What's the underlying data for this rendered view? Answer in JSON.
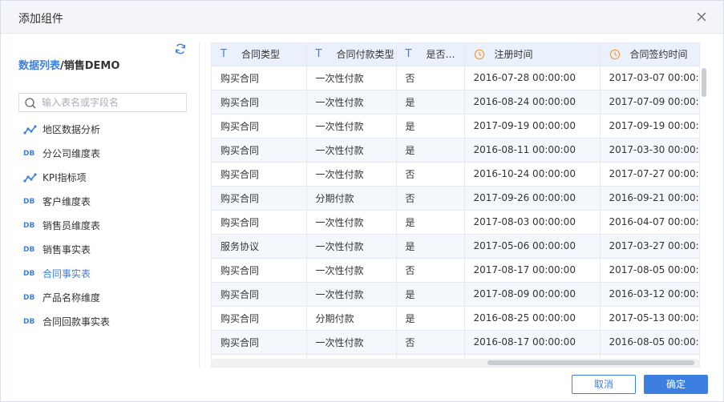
{
  "dialog": {
    "title": "添加组件",
    "cancel_label": "取消",
    "ok_label": "确定"
  },
  "breadcrumb": {
    "root": "数据列表",
    "separator": "/",
    "current": "销售DEMO"
  },
  "search": {
    "placeholder": "输入表名或字段名",
    "value": ""
  },
  "tree": [
    {
      "icon": "analysis-icon",
      "label": "地区数据分析",
      "active": false
    },
    {
      "icon": "db-icon",
      "icon_text": "DB",
      "label": "分公司维度表",
      "active": false
    },
    {
      "icon": "analysis-icon",
      "label": "KPI指标项",
      "active": false
    },
    {
      "icon": "db-icon",
      "icon_text": "DB",
      "label": "客户维度表",
      "active": false
    },
    {
      "icon": "db-icon",
      "icon_text": "DB",
      "label": "销售员维度表",
      "active": false
    },
    {
      "icon": "db-icon",
      "icon_text": "DB",
      "label": "销售事实表",
      "active": false
    },
    {
      "icon": "db-icon",
      "icon_text": "DB",
      "label": "合同事实表",
      "active": true
    },
    {
      "icon": "db-icon",
      "icon_text": "DB",
      "label": "产品名称维度",
      "active": false
    },
    {
      "icon": "db-icon",
      "icon_text": "DB",
      "label": "合同回款事实表",
      "active": false
    }
  ],
  "table": {
    "columns": [
      {
        "type": "text",
        "type_glyph": "T",
        "label": "合同类型"
      },
      {
        "type": "text",
        "type_glyph": "T",
        "label": "合同付款类型"
      },
      {
        "type": "text",
        "type_glyph": "T",
        "label": "是否已..."
      },
      {
        "type": "date",
        "type_glyph": "clock-icon",
        "label": "注册时间"
      },
      {
        "type": "date",
        "type_glyph": "clock-icon",
        "label": "合同签约时间"
      }
    ],
    "rows": [
      [
        "购买合同",
        "一次性付款",
        "否",
        "2016-07-28 00:00:00",
        "2017-03-07 00:00:00"
      ],
      [
        "购买合同",
        "一次性付款",
        "是",
        "2016-08-24 00:00:00",
        "2017-07-09 00:00:00"
      ],
      [
        "购买合同",
        "一次性付款",
        "是",
        "2017-09-19 00:00:00",
        "2017-09-19 00:00:00"
      ],
      [
        "购买合同",
        "一次性付款",
        "是",
        "2016-08-11 00:00:00",
        "2017-03-30 00:00:00"
      ],
      [
        "购买合同",
        "一次性付款",
        "否",
        "2016-10-24 00:00:00",
        "2017-07-27 00:00:00"
      ],
      [
        "购买合同",
        "分期付款",
        "否",
        "2017-09-26 00:00:00",
        "2016-09-21 00:00:00"
      ],
      [
        "购买合同",
        "一次性付款",
        "是",
        "2017-08-03 00:00:00",
        "2016-04-07 00:00:00"
      ],
      [
        "服务协议",
        "一次性付款",
        "是",
        "2017-05-06 00:00:00",
        "2017-03-27 00:00:00"
      ],
      [
        "购买合同",
        "一次性付款",
        "否",
        "2017-08-17 00:00:00",
        "2017-08-05 00:00:00"
      ],
      [
        "购买合同",
        "一次性付款",
        "是",
        "2017-08-09 00:00:00",
        "2016-03-12 00:00:00"
      ],
      [
        "购买合同",
        "分期付款",
        "是",
        "2016-08-25 00:00:00",
        "2017-05-13 00:00:00"
      ],
      [
        "购买合同",
        "一次性付款",
        "否",
        "2016-08-17 00:00:00",
        "2016-08-05 00:00:00"
      ],
      [
        "",
        "",
        "",
        "",
        ""
      ]
    ]
  },
  "colors": {
    "accent": "#3d7fe0",
    "date_icon": "#f0a046",
    "header_bg": "#eaf1fc"
  }
}
